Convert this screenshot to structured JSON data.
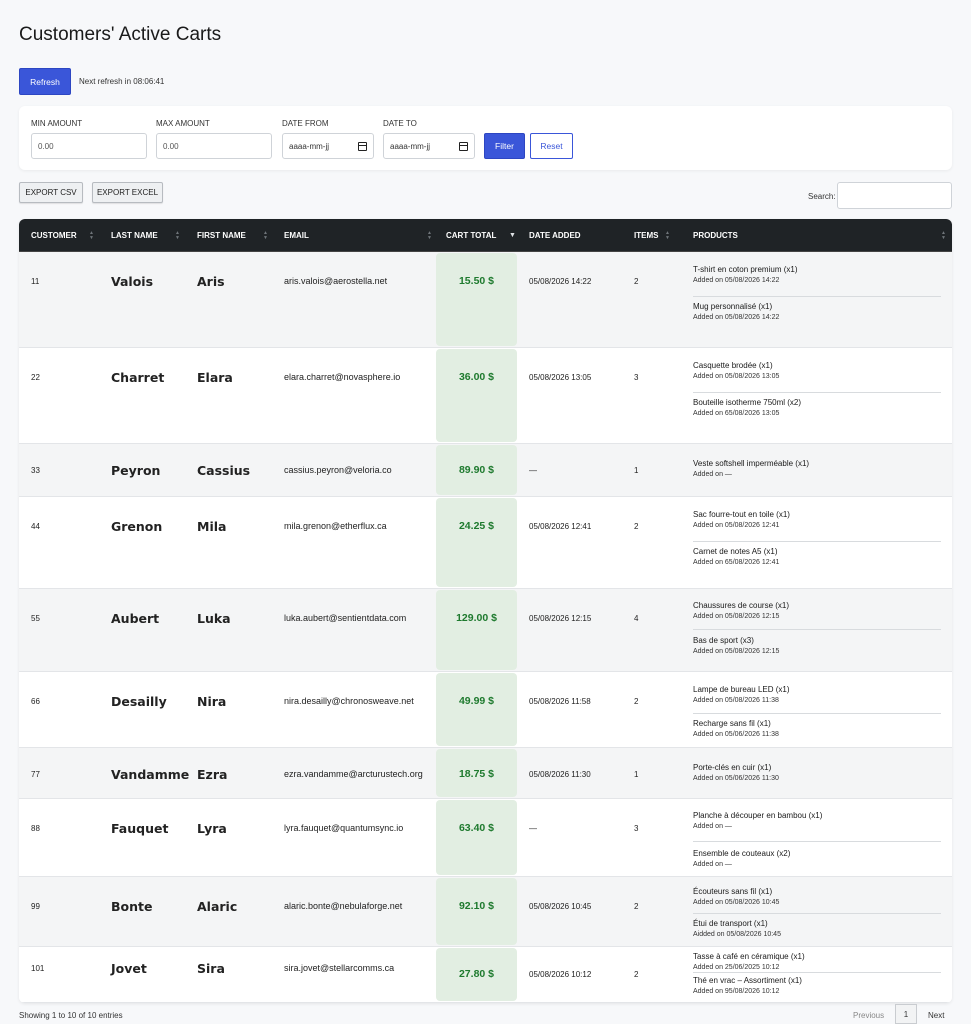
{
  "page": {
    "title": "Customers' Active Carts"
  },
  "toolbar": {
    "refresh_label": "Refresh",
    "refresh_note": "Next refresh in 08:06:41"
  },
  "filters": {
    "min_amount_label": "MIN AMOUNT",
    "min_amount_placeholder": "0.00",
    "max_amount_label": "MAX AMOUNT",
    "max_amount_placeholder": "0.00",
    "date_from_label": "DATE FROM",
    "date_from_value": "aaaa-mm-jj",
    "date_to_label": "DATE TO",
    "date_to_value": "aaaa-mm-jj",
    "filter_label": "Filter",
    "reset_label": "Reset"
  },
  "export": {
    "csv_label": "EXPORT CSV",
    "excel_label": "EXPORT EXCEL"
  },
  "search": {
    "label": "Search:"
  },
  "table": {
    "columns": [
      "CUSTOMER",
      "LAST NAME",
      "FIRST NAME",
      "EMAIL",
      "CART TOTAL",
      "DATE ADDED",
      "ITEMS",
      "PRODUCTS"
    ],
    "sorted_column": "CART TOTAL",
    "rows": [
      {
        "customer": "11",
        "last_name": "Valois",
        "first_name": "Aris",
        "email": "aris.valois@aerostella.net",
        "total": "15.50 $",
        "date_added": "05/08/2026 14:22",
        "items": "2",
        "products": [
          {
            "name": "T-shirt en coton premium (x1)",
            "added": "Added on 05/08/2026 14:22"
          },
          {
            "name": "Mug personnalisé (x1)",
            "added": "Added on 05/08/2026 14:22"
          }
        ]
      },
      {
        "customer": "22",
        "last_name": "Charret",
        "first_name": "Elara",
        "email": "elara.charret@novasphere.io",
        "total": "36.00 $",
        "date_added": "05/08/2026 13:05",
        "items": "3",
        "products": [
          {
            "name": "Casquette brodée (x1)",
            "added": "Added on 05/08/2026 13:05"
          },
          {
            "name": "Bouteille isotherme 750ml (x2)",
            "added": "Added on 65/08/2026 13:05"
          }
        ]
      },
      {
        "customer": "33",
        "last_name": "Peyron",
        "first_name": "Cassius",
        "email": "cassius.peyron@veloria.co",
        "total": "89.90 $",
        "date_added": "—",
        "items": "1",
        "products": [
          {
            "name": "Veste softshell imperméable (x1)",
            "added": "Added on —"
          }
        ]
      },
      {
        "customer": "44",
        "last_name": "Grenon",
        "first_name": "Mila",
        "email": "mila.grenon@etherflux.ca",
        "total": "24.25 $",
        "date_added": "05/08/2026 12:41",
        "items": "2",
        "products": [
          {
            "name": "Sac fourre-tout en toile (x1)",
            "added": "Added on 05/08/2026 12:41"
          },
          {
            "name": "Carnet de notes A5 (x1)",
            "added": "Added on 65/08/2026 12:41"
          }
        ]
      },
      {
        "customer": "55",
        "last_name": "Aubert",
        "first_name": "Luka",
        "email": "luka.aubert@sentientdata.com",
        "total": "129.00 $",
        "date_added": "05/08/2026 12:15",
        "items": "4",
        "products": [
          {
            "name": "Chaussures de course (x1)",
            "added": "Added on 05/08/2026 12:15"
          },
          {
            "name": "Bas de sport (x3)",
            "added": "Added on 05/08/2026 12:15"
          }
        ]
      },
      {
        "customer": "66",
        "last_name": "Desailly",
        "first_name": "Nira",
        "email": "nira.desailly@chronosweave.net",
        "total": "49.99 $",
        "date_added": "05/08/2026 11:58",
        "items": "2",
        "products": [
          {
            "name": "Lampe de bureau LED (x1)",
            "added": "Added on 05/08/2026 11:38"
          },
          {
            "name": "Recharge sans fil (x1)",
            "added": "Added on 05/06/2026 11:38"
          }
        ]
      },
      {
        "customer": "77",
        "last_name": "Vandamme",
        "first_name": "Ezra",
        "email": "ezra.vandamme@arcturustech.org",
        "total": "18.75 $",
        "date_added": "05/08/2026 11:30",
        "items": "1",
        "products": [
          {
            "name": "Porte-clés en cuir (x1)",
            "added": "Added on 05/06/2026 11:30"
          }
        ]
      },
      {
        "customer": "88",
        "last_name": "Fauquet",
        "first_name": "Lyra",
        "email": "lyra.fauquet@quantumsync.io",
        "total": "63.40 $",
        "date_added": "—",
        "items": "3",
        "products": [
          {
            "name": "Planche à découper en bambou (x1)",
            "added": "Added on —"
          },
          {
            "name": "Ensemble de couteaux (x2)",
            "added": "Added on —"
          }
        ]
      },
      {
        "customer": "99",
        "last_name": "Bonte",
        "first_name": "Alaric",
        "email": "alaric.bonte@nebulaforge.net",
        "total": "92.10 $",
        "date_added": "05/08/2026 10:45",
        "items": "2",
        "products": [
          {
            "name": "Écouteurs sans fil (x1)",
            "added": "Added on 05/08/2026 10:45"
          },
          {
            "name": "Étui de transport (x1)",
            "added": "Aidded on 05/08/2026 10:45"
          }
        ]
      },
      {
        "customer": "101",
        "last_name": "Jovet",
        "first_name": "Sira",
        "email": "sira.jovet@stellarcomms.ca",
        "total": "27.80 $",
        "date_added": "05/08/2026 10:12",
        "items": "2",
        "products": [
          {
            "name": "Tasse à café en céramique (x1)",
            "added": "Added on 25/06/2025 10:12"
          },
          {
            "name": "Thé en vrac – Assortiment (x1)",
            "added": "Added on 95/08/2026 10:12"
          }
        ]
      }
    ]
  },
  "footer": {
    "info": "Showing 1 to 10 of 10 entries",
    "previous": "Previous",
    "page": "1",
    "next": "Next"
  },
  "colors": {
    "primary": "#3a56d9",
    "header_bg": "#1f2326",
    "total_bg": "#e2eee2",
    "total_text": "#1e7a2e"
  }
}
